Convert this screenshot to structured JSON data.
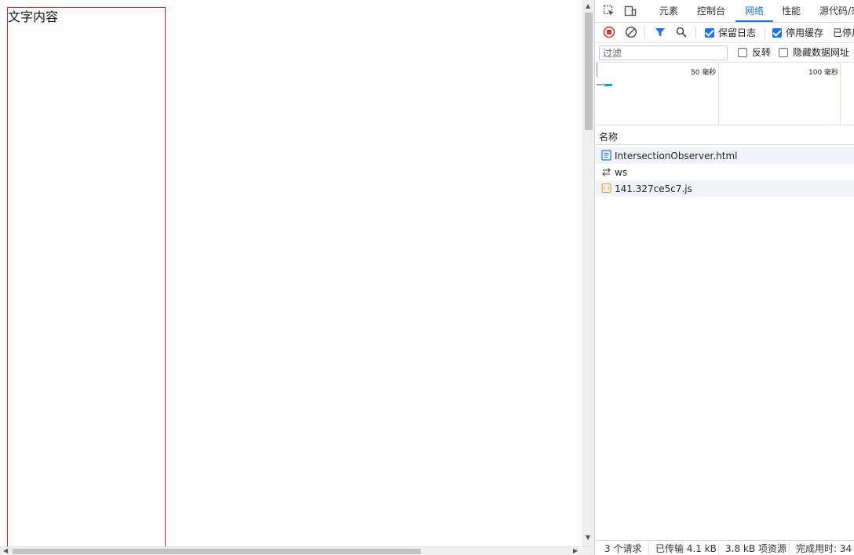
{
  "page": {
    "content_text": "文字内容"
  },
  "devtools": {
    "tabs": [
      {
        "label": "元素"
      },
      {
        "label": "控制台"
      },
      {
        "label": "网络",
        "active": true
      },
      {
        "label": "性能"
      },
      {
        "label": "源代码/来源"
      }
    ],
    "toolbar": {
      "preserve_log_label": "保留日志",
      "preserve_log_checked": true,
      "disable_cache_label": "停用缓存",
      "disable_cache_checked": true,
      "throttling_label": "已停用节流"
    },
    "filter": {
      "placeholder": "过滤",
      "invert_label": "反转",
      "invert_checked": false,
      "hide_data_urls_label": "隐藏数据网址",
      "hide_data_urls_checked": false
    },
    "overview": {
      "ticks": [
        "50 毫秒",
        "100 毫秒"
      ]
    },
    "list": {
      "name_header": "名称",
      "requests": [
        {
          "name": "IntersectionObserver.html",
          "icon": "document-icon"
        },
        {
          "name": "ws",
          "icon": "websocket-icon"
        },
        {
          "name": "141.327ce5c7.js",
          "icon": "script-icon"
        }
      ]
    },
    "status": {
      "requests": "3 个请求",
      "transferred": "已传输 4.1 kB",
      "resources": "3.8 kB 项资源",
      "finish": "完成用时: 34"
    },
    "colors": {
      "accent": "#1a73e8",
      "record": "#d93025",
      "box_border": "#d32b2b"
    }
  }
}
